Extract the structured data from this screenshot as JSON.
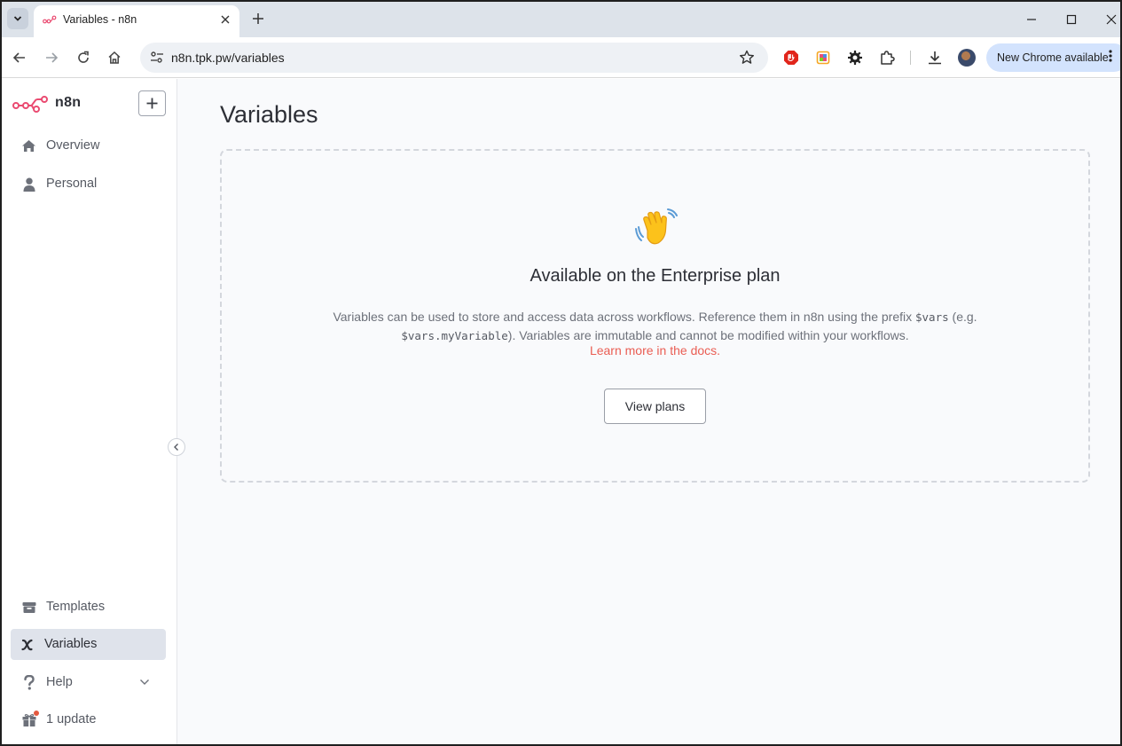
{
  "browser": {
    "tab_title": "Variables - n8n",
    "url": "n8n.tpk.pw/variables",
    "update_label": "New Chrome available"
  },
  "sidebar": {
    "brand": "n8n",
    "add_button": "+",
    "items_top": [
      {
        "label": "Overview",
        "icon": "home-icon"
      },
      {
        "label": "Personal",
        "icon": "user-icon"
      }
    ],
    "items_bottom": [
      {
        "label": "Templates",
        "icon": "box-icon"
      },
      {
        "label": "Variables",
        "icon": "variable-icon",
        "active": true
      },
      {
        "label": "Help",
        "icon": "question-icon"
      },
      {
        "label": "1 update",
        "icon": "gift-icon"
      }
    ]
  },
  "main": {
    "title": "Variables",
    "card": {
      "emoji": "👋",
      "heading": "Available on the Enterprise plan",
      "desc_part1": "Variables can be used to store and access data across workflows. Reference them in n8n using the prefix ",
      "desc_code1": "$vars",
      "desc_part2": " (e.g. ",
      "desc_code2": "$vars.myVariable",
      "desc_part3": "). Variables are immutable and cannot be modified within your workflows.",
      "link": "Learn more in the docs.",
      "button": "View plans"
    }
  },
  "colors": {
    "brand": "#ea4b71",
    "link": "#ea5d53",
    "active_nav": "#dfe3eb"
  }
}
